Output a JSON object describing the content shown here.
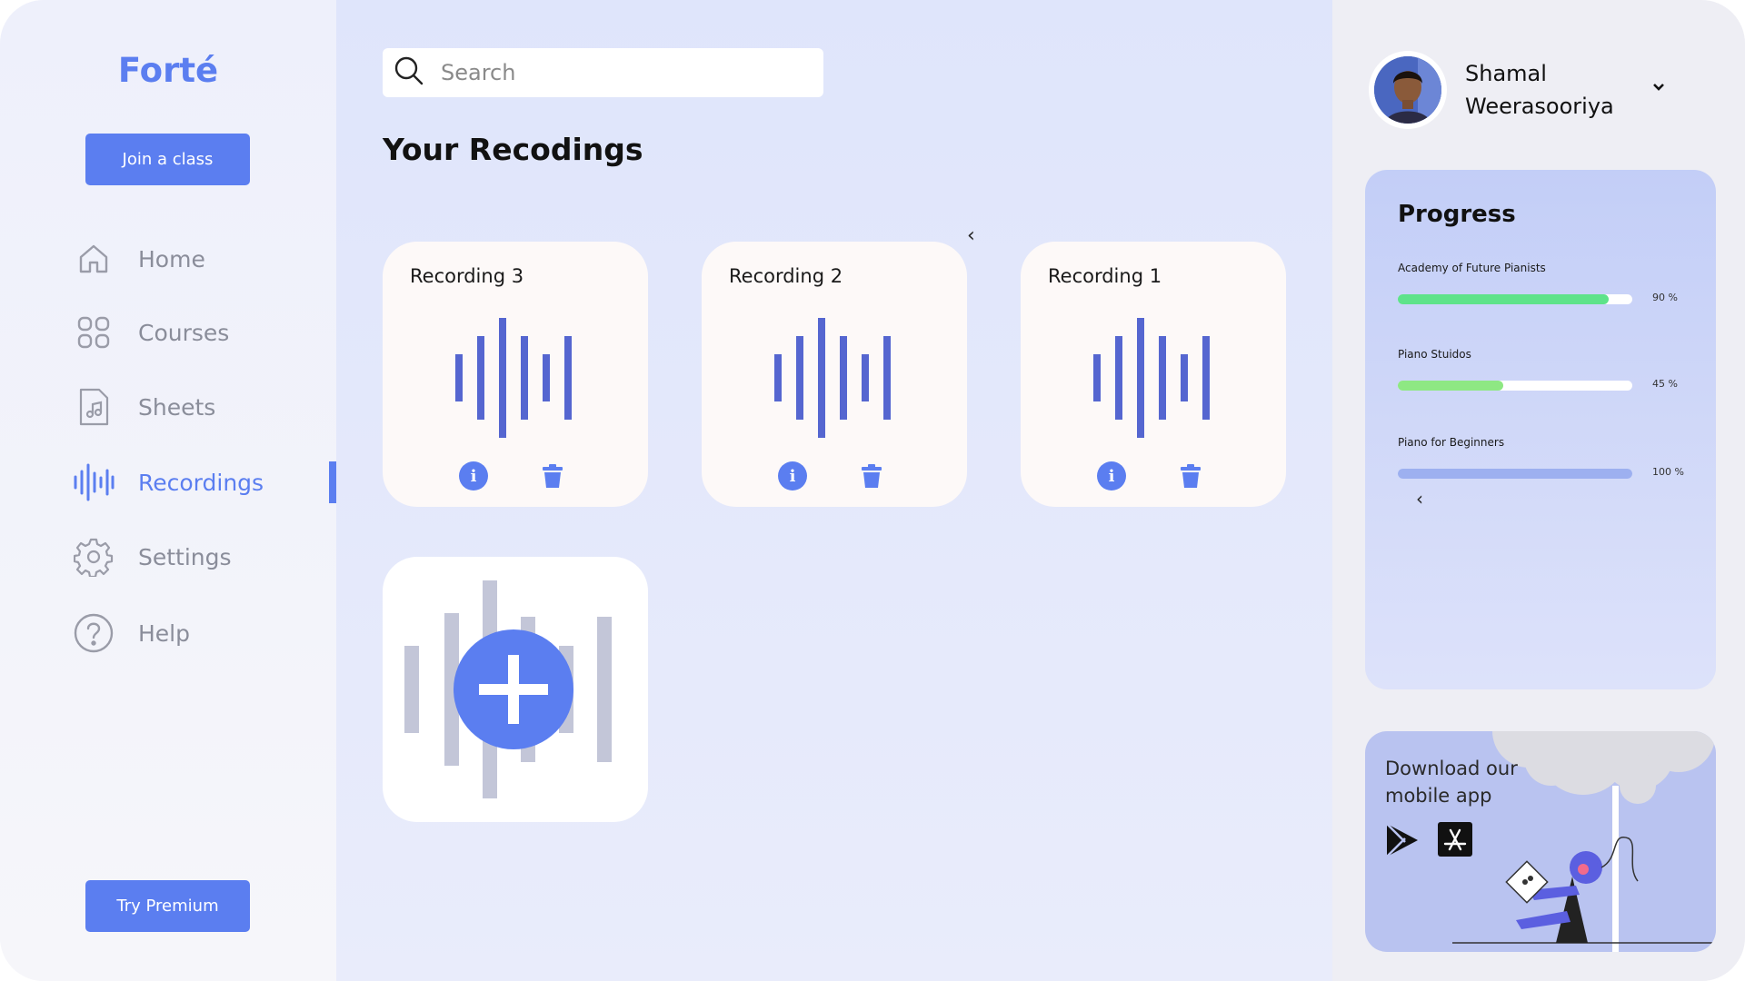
{
  "app": {
    "name": "Forté"
  },
  "sidebar": {
    "join_label": "Join a class",
    "premium_label": "Try Premium",
    "items": [
      {
        "label": "Home",
        "icon": "home-icon"
      },
      {
        "label": "Courses",
        "icon": "grid-icon"
      },
      {
        "label": "Sheets",
        "icon": "sheet-music-icon"
      },
      {
        "label": "Recordings",
        "icon": "audio-wave-icon",
        "active": true
      },
      {
        "label": "Settings",
        "icon": "gear-icon"
      },
      {
        "label": "Help",
        "icon": "help-icon"
      }
    ]
  },
  "search": {
    "placeholder": "Search"
  },
  "main": {
    "title": "Your Recodings",
    "scroll_arrow": "‹",
    "recordings": [
      {
        "title": "Recording 3"
      },
      {
        "title": "Recording 2"
      },
      {
        "title": "Recording 1"
      }
    ],
    "info_glyph": "i"
  },
  "profile": {
    "first": "Shamal",
    "last": "Weerasooriya"
  },
  "progress": {
    "title": "Progress",
    "scroll_arrow": "‹",
    "items": [
      {
        "name": "Academy of Future Pianists",
        "percent": 90,
        "label": "90 %",
        "color": "#5ee38a"
      },
      {
        "name": "Piano Stuidos",
        "percent": 45,
        "label": "45 %",
        "color": "#8ee883"
      },
      {
        "name": "Piano for Beginners",
        "percent": 100,
        "label": "100 %",
        "color": "#9db0f0"
      }
    ]
  },
  "download": {
    "text_line1": "Download our",
    "text_line2": "mobile app"
  },
  "colors": {
    "accent": "#5b7ef0",
    "wave": "#5566d0",
    "wave_muted": "#c3c6d8"
  }
}
